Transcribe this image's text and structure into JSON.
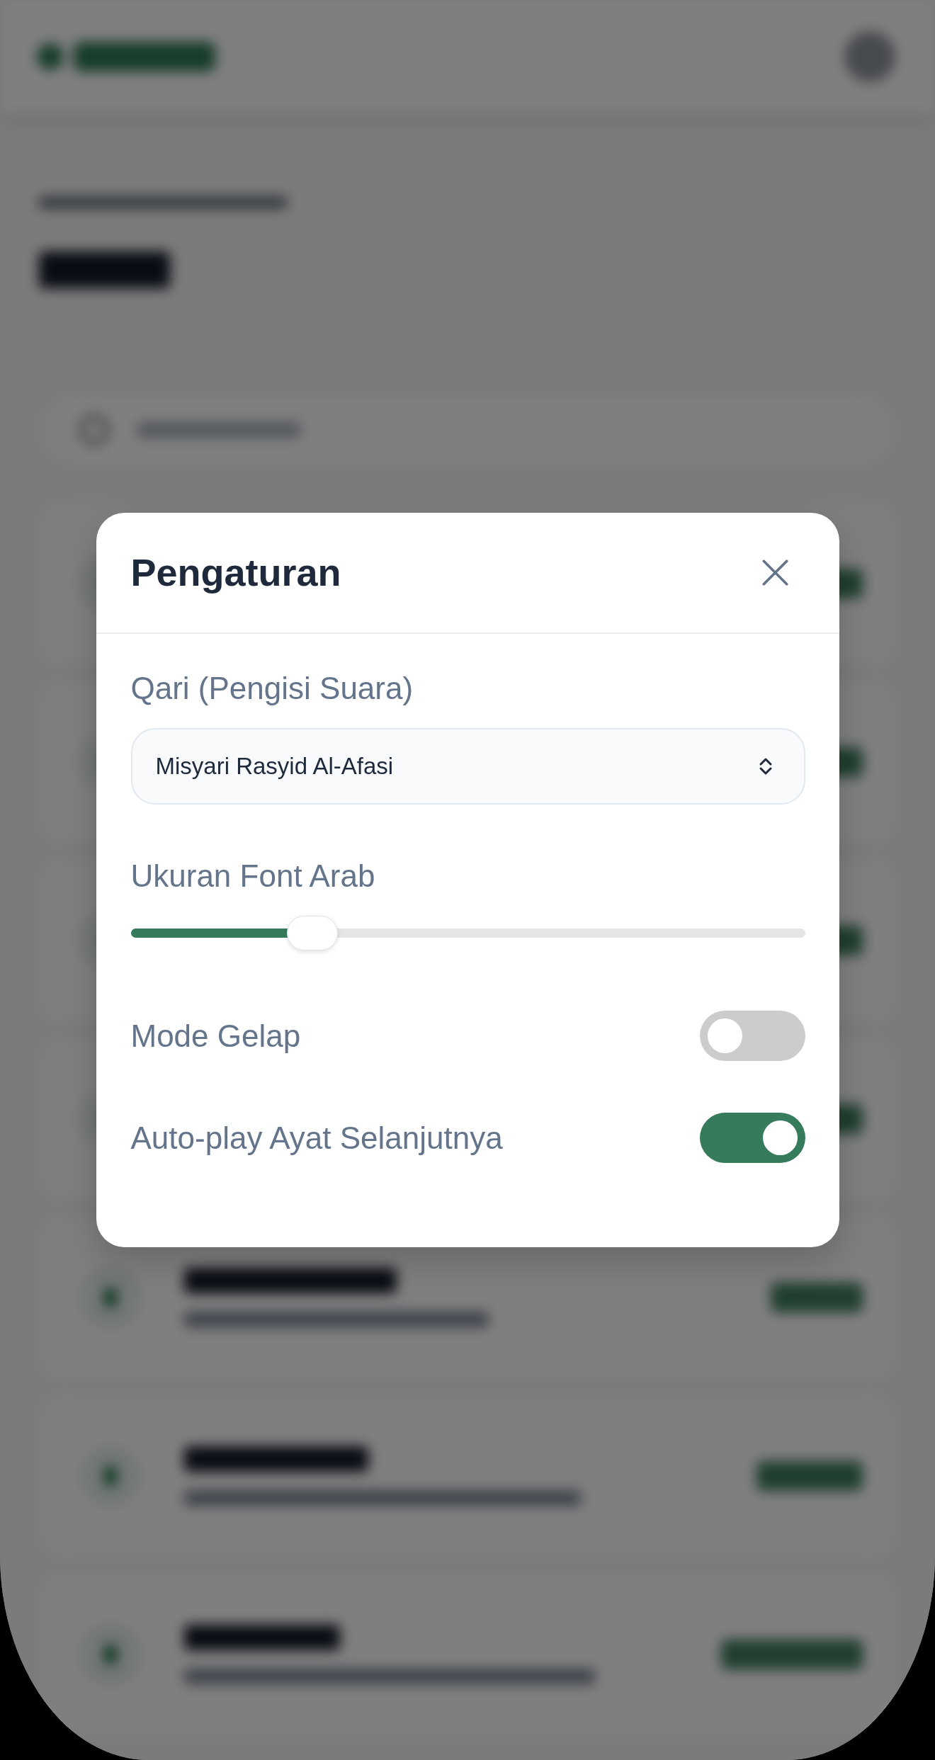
{
  "dialog": {
    "title": "Pengaturan"
  },
  "settings": [
    {
      "kind": "select",
      "label": "Qari (Pengisi Suara)",
      "value": "Misyari Rasyid Al-Afasi"
    },
    {
      "kind": "slider",
      "label": "Ukuran Font Arab",
      "level": 0.25
    },
    {
      "kind": "toggle",
      "label": "Mode Gelap",
      "on": false
    },
    {
      "kind": "toggle",
      "label": "Auto-play Ayat Selanjutnya",
      "on": true
    }
  ]
}
